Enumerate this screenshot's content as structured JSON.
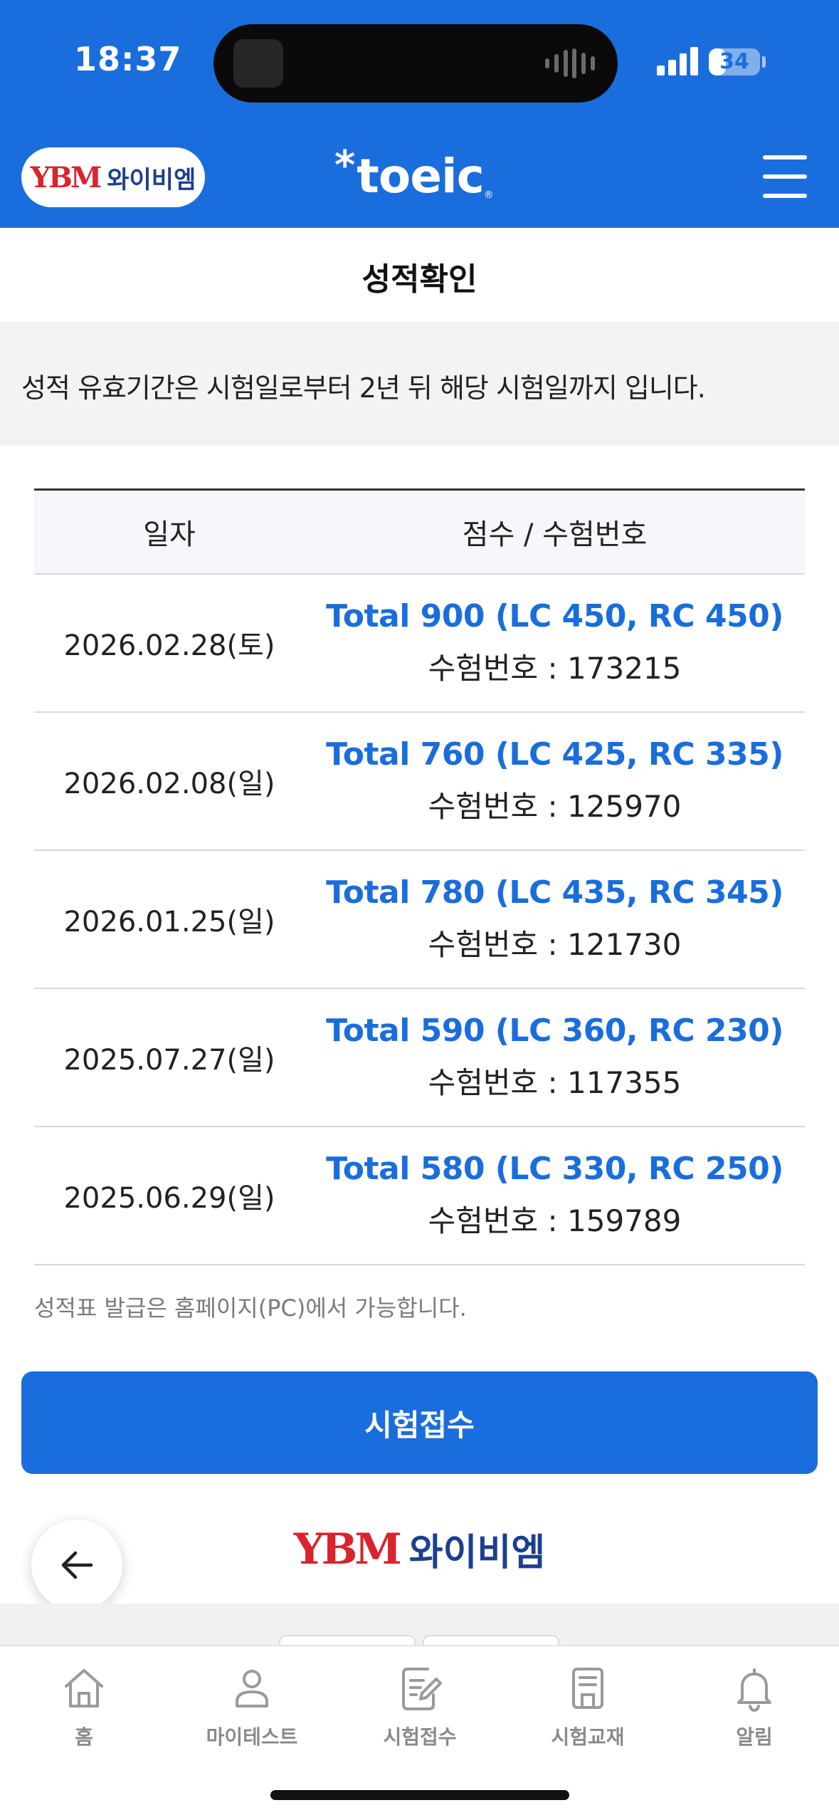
{
  "status_bar": {
    "time": "18:37",
    "battery": "34",
    "battery_level": 0.34
  },
  "header": {
    "partner_mark": "YBM",
    "partner_name": "와이비엠",
    "brand_star": "*",
    "brand": "toeic",
    "brand_reg": "®"
  },
  "page": {
    "title": "성적확인"
  },
  "notice": "성적 유효기간은 시험일로부터 2년 뒤 해당 시험일까지 입니다.",
  "table": {
    "headers": [
      "일자",
      "점수 / 수험번호"
    ],
    "rows": [
      {
        "date": "2026.02.28(토)",
        "score": "Total 900 (LC 450, RC 450)",
        "exam_no": "수험번호 : 173215"
      },
      {
        "date": "2026.02.08(일)",
        "score": "Total 760 (LC 425, RC 335)",
        "exam_no": "수험번호 : 125970"
      },
      {
        "date": "2026.01.25(일)",
        "score": "Total 780 (LC 435, RC 345)",
        "exam_no": "수험번호 : 121730"
      },
      {
        "date": "2025.07.27(일)",
        "score": "Total 590 (LC 360, RC 230)",
        "exam_no": "수험번호 : 117355"
      },
      {
        "date": "2025.06.29(일)",
        "score": "Total 580 (LC 330, RC 250)",
        "exam_no": "수험번호 : 159789"
      }
    ]
  },
  "footnote": "성적표 발급은 홈페이지(PC)에서 가능합니다.",
  "primary_button": "시험접수",
  "footer": {
    "mark": "YBM",
    "name": "와이비엠"
  },
  "tabbar": {
    "items": [
      {
        "label": "홈",
        "icon": "home-icon"
      },
      {
        "label": "마이테스트",
        "icon": "person-icon"
      },
      {
        "label": "시험접수",
        "icon": "edit-document-icon"
      },
      {
        "label": "시험교재",
        "icon": "book-icon"
      },
      {
        "label": "알림",
        "icon": "bell-icon"
      }
    ]
  },
  "colors": {
    "brand_blue": "#1a6ddc",
    "ybm_red": "#d9232d",
    "ybm_navy": "#1c3f8f"
  }
}
